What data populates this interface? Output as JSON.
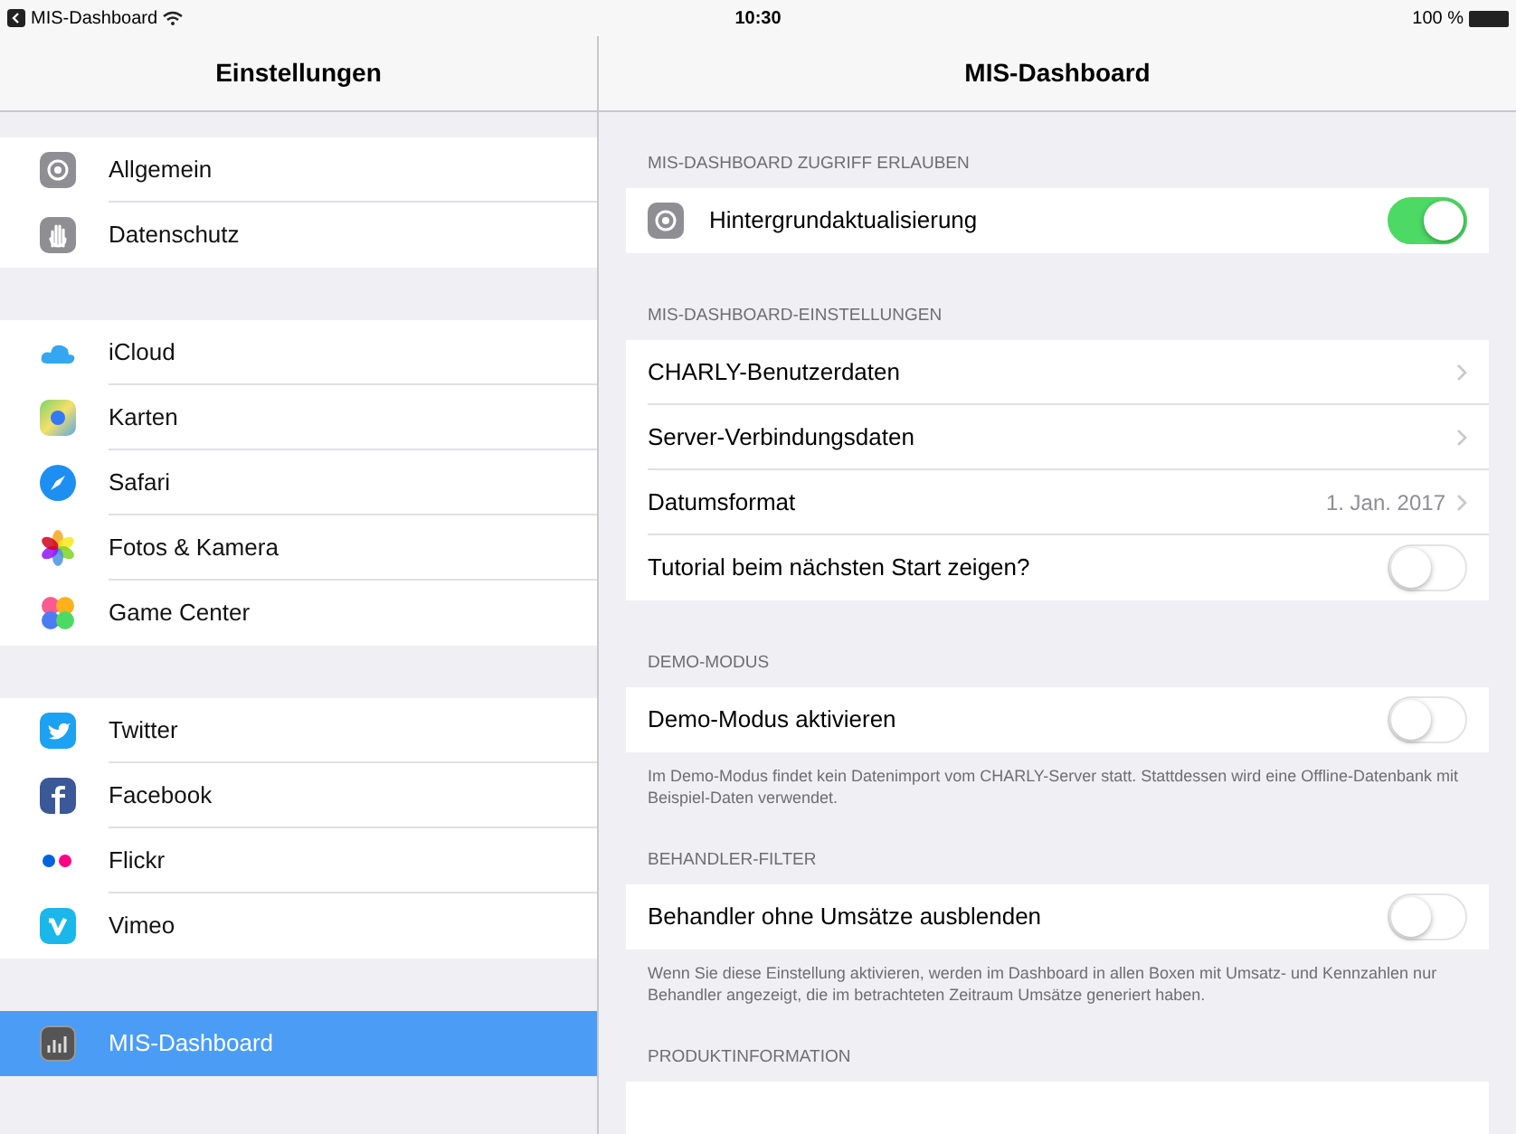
{
  "status_bar": {
    "back_app": "MIS-Dashboard",
    "time": "10:30",
    "battery": "100 %"
  },
  "sidebar": {
    "title": "Einstellungen",
    "groups": [
      {
        "items": [
          {
            "label": "Allgemein",
            "selected": false
          },
          {
            "label": "Datenschutz",
            "selected": false
          }
        ]
      },
      {
        "items": [
          {
            "label": "iCloud",
            "selected": false
          },
          {
            "label": "Karten",
            "selected": false
          },
          {
            "label": "Safari",
            "selected": false
          },
          {
            "label": "Fotos & Kamera",
            "selected": false
          },
          {
            "label": "Game Center",
            "selected": false
          }
        ]
      },
      {
        "items": [
          {
            "label": "Twitter",
            "selected": false
          },
          {
            "label": "Facebook",
            "selected": false
          },
          {
            "label": "Flickr",
            "selected": false
          },
          {
            "label": "Vimeo",
            "selected": false
          }
        ]
      },
      {
        "items": [
          {
            "label": "MIS-Dashboard",
            "selected": true
          }
        ]
      }
    ]
  },
  "detail": {
    "title": "MIS-Dashboard",
    "sections": [
      {
        "header": "MIS-DASHBOARD ZUGRIFF ERLAUBEN",
        "rows": [
          {
            "kind": "toggle",
            "label": "Hintergrundaktualisierung",
            "on": true,
            "has_icon": true
          }
        ]
      },
      {
        "header": "MIS-DASHBOARD-EINSTELLUNGEN",
        "rows": [
          {
            "kind": "link",
            "label": "CHARLY-Benutzerdaten"
          },
          {
            "kind": "link",
            "label": "Server-Verbindungsdaten"
          },
          {
            "kind": "link",
            "label": "Datumsformat",
            "value": "1. Jan. 2017"
          },
          {
            "kind": "toggle",
            "label": "Tutorial beim nächsten Start zeigen?",
            "on": false
          }
        ]
      },
      {
        "header": "DEMO-MODUS",
        "rows": [
          {
            "kind": "toggle",
            "label": "Demo-Modus aktivieren",
            "on": false
          }
        ],
        "footer": "Im Demo-Modus findet kein Datenimport vom CHARLY-Server statt. Stattdessen wird eine Offline-Datenbank mit Beispiel-Daten verwendet."
      },
      {
        "header": "BEHANDLER-FILTER",
        "rows": [
          {
            "kind": "toggle",
            "label": "Behandler ohne Umsätze ausblenden",
            "on": false
          }
        ],
        "footer": "Wenn Sie diese Einstellung aktivieren, werden im Dashboard in allen Boxen mit Umsatz- und Kennzahlen nur Behandler angezeigt, die im betrachteten Zeitraum Umsätze generiert haben."
      },
      {
        "header": "PRODUKTINFORMATION",
        "rows": [
          {
            "kind": "blank"
          }
        ]
      }
    ]
  }
}
